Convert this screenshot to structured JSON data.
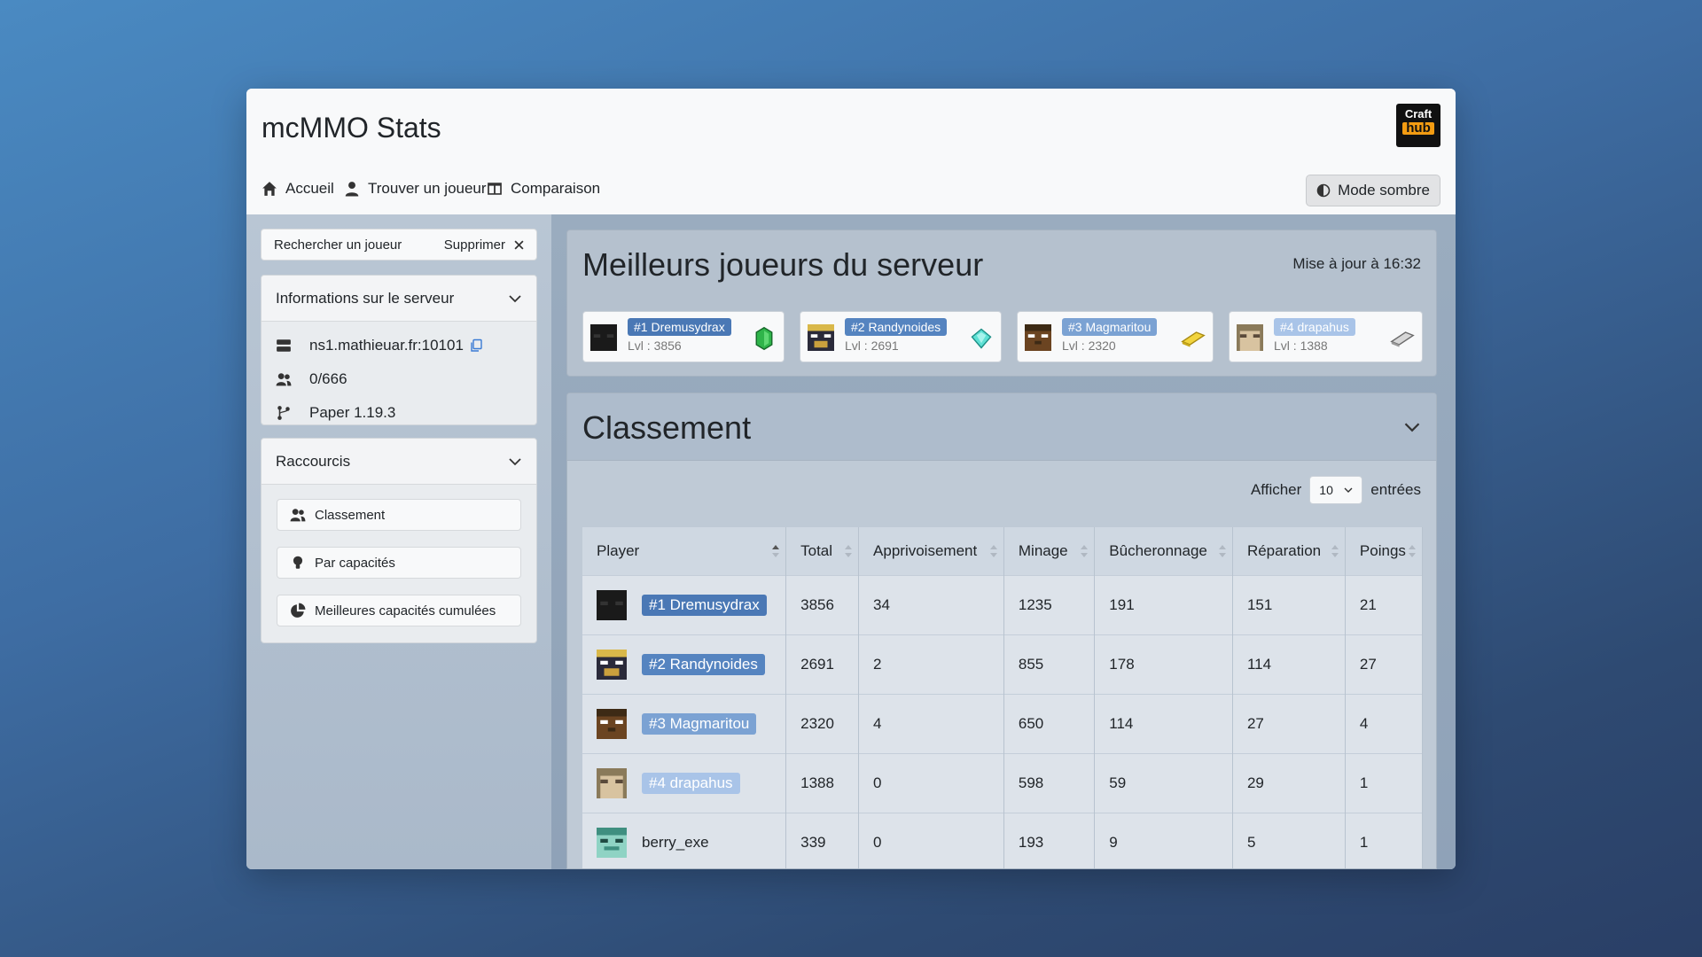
{
  "app": {
    "title": "mcMMO Stats",
    "logo_top": "Craft",
    "logo_bottom": "hub"
  },
  "nav": {
    "home": "Accueil",
    "find_player": "Trouver un joueur",
    "compare": "Comparaison",
    "dark_mode": "Mode sombre"
  },
  "sidebar": {
    "search_label": "Rechercher un joueur",
    "clear_label": "Supprimer",
    "server_info": {
      "title": "Informations sur le serveur",
      "address": "ns1.mathieuar.fr:10101",
      "players": "0/666",
      "version": "Paper 1.19.3"
    },
    "shortcuts": {
      "title": "Raccourcis",
      "items": [
        "Classement",
        "Par capacités",
        "Meilleures capacités cumulées"
      ]
    }
  },
  "top_players": {
    "title": "Meilleurs joueurs du serveur",
    "updated": "Mise à jour à 16:32",
    "players": [
      {
        "badge": "#1 Dremusydrax",
        "level": "Lvl : 3856",
        "badge_color": "#4a78b5",
        "award": "emerald-icon"
      },
      {
        "badge": "#2 Randynoides",
        "level": "Lvl : 2691",
        "badge_color": "#5584c0",
        "award": "diamond-icon"
      },
      {
        "badge": "#3 Magmaritou",
        "level": "Lvl : 2320",
        "badge_color": "#7ba2d3",
        "award": "gold-ingot-icon"
      },
      {
        "badge": "#4 drapahus",
        "level": "Lvl : 1388",
        "badge_color": "#a9c4e8",
        "award": "iron-ingot-icon"
      }
    ]
  },
  "ranking": {
    "title": "Classement",
    "show_label": "Afficher",
    "show_value": "10",
    "entries_label": "entrées",
    "columns": [
      "Player",
      "Total",
      "Apprivoisement",
      "Minage",
      "Bûcheronnage",
      "Réparation",
      "Poings"
    ],
    "rows": [
      {
        "player": "#1 Dremusydrax",
        "badge_color": "#4a78b5",
        "values": [
          "3856",
          "34",
          "1235",
          "191",
          "151",
          "21"
        ]
      },
      {
        "player": "#2 Randynoides",
        "badge_color": "#5584c0",
        "values": [
          "2691",
          "2",
          "855",
          "178",
          "114",
          "27"
        ]
      },
      {
        "player": "#3 Magmaritou",
        "badge_color": "#7ba2d3",
        "values": [
          "2320",
          "4",
          "650",
          "114",
          "27",
          "4"
        ]
      },
      {
        "player": "#4 drapahus",
        "badge_color": "#a9c4e8",
        "values": [
          "1388",
          "0",
          "598",
          "59",
          "29",
          "1"
        ]
      },
      {
        "player": "berry_exe",
        "badge_color": "",
        "values": [
          "339",
          "0",
          "193",
          "9",
          "5",
          "1"
        ]
      }
    ]
  }
}
